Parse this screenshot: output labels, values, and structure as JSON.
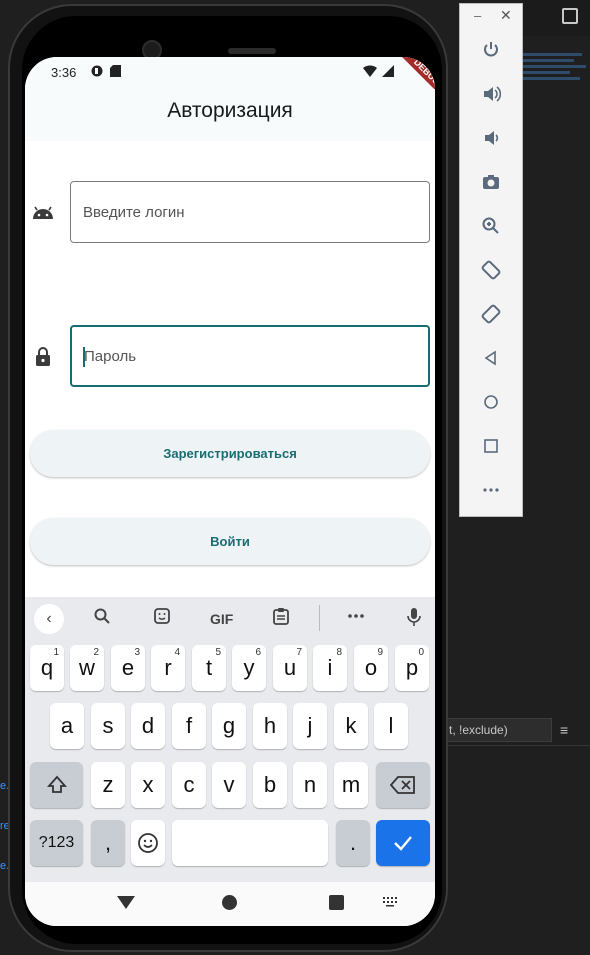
{
  "ide": {
    "filter_text": "t, !exclude)",
    "left_marks": [
      "e.",
      "re",
      "e."
    ]
  },
  "emulator": {
    "minimize": "–",
    "close": "✕",
    "buttons": [
      "power",
      "volume-up",
      "volume-down",
      "camera",
      "zoom",
      "rotate-left",
      "rotate-right",
      "back",
      "home",
      "overview",
      "more"
    ]
  },
  "status": {
    "time": "3:36",
    "debug": "DEBUG"
  },
  "app": {
    "title": "Авторизация",
    "login_placeholder": "Введите логин",
    "password_placeholder": "Пароль",
    "register_label": "Зарегистрироваться",
    "login_label": "Войти"
  },
  "keyboard": {
    "toolbar": {
      "gif": "GIF"
    },
    "row1": [
      {
        "k": "q",
        "s": "1"
      },
      {
        "k": "w",
        "s": "2"
      },
      {
        "k": "e",
        "s": "3"
      },
      {
        "k": "r",
        "s": "4"
      },
      {
        "k": "t",
        "s": "5"
      },
      {
        "k": "y",
        "s": "6"
      },
      {
        "k": "u",
        "s": "7"
      },
      {
        "k": "i",
        "s": "8"
      },
      {
        "k": "o",
        "s": "9"
      },
      {
        "k": "p",
        "s": "0"
      }
    ],
    "row2": [
      "a",
      "s",
      "d",
      "f",
      "g",
      "h",
      "j",
      "k",
      "l"
    ],
    "row3": [
      "z",
      "x",
      "c",
      "v",
      "b",
      "n",
      "m"
    ],
    "symbols": "?123",
    "comma": ",",
    "period": "."
  }
}
